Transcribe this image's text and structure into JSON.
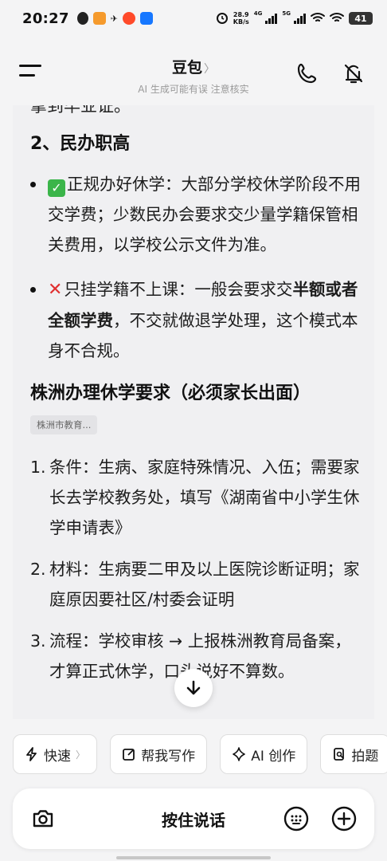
{
  "status_bar": {
    "time": "20:27",
    "net_speed_value": "28.9",
    "net_speed_unit": "KB/s",
    "net1": "4G",
    "net2": "5G",
    "battery": "41"
  },
  "header": {
    "title": "豆包",
    "subtitle": "AI 生成可能有误 注意核实"
  },
  "message": {
    "cut_text": "拿到毕业证。",
    "section2_heading": "2、民办职高",
    "bullets": [
      {
        "emoji": "✓",
        "lead": "正规办好休学：大部分学校休学阶段不用交学费；少数民办会要求交少量学籍保管相关费用，以学校公示文件为准。"
      },
      {
        "emoji": "✕",
        "lead": "只挂学籍不上课：一般会要求交",
        "bold": "半额或者全额学费",
        "tail": "，不交就做退学处理，这个模式本身不合规。"
      }
    ],
    "zhuzhou_heading": "株洲办理休学要求（必须家长出面）",
    "source_tag": "株洲市教育...",
    "steps": [
      {
        "num": "1.",
        "text": "条件：生病、家庭特殊情况、入伍；需要家长去学校教务处，填写《湖南省中小学生休学申请表》"
      },
      {
        "num": "2.",
        "text": "材料：生病要二甲及以上医院诊断证明；家庭原因要社区/村委会证明"
      },
      {
        "num": "3.",
        "text": "流程：学校审核 → 上报株洲教育局备案，才算正式休学，口头说好不算数。"
      }
    ]
  },
  "quick_actions": [
    {
      "label": "快速",
      "icon": "lightning-icon"
    },
    {
      "label": "帮我写作",
      "icon": "edit-icon"
    },
    {
      "label": "AI 创作",
      "icon": "sparkle-icon"
    },
    {
      "label": "拍题",
      "icon": "scan-icon"
    }
  ],
  "input_bar": {
    "hold_to_talk": "按住说话"
  },
  "colors": {
    "background": "#f4f4f5",
    "card": "#f0f0f2",
    "check_green": "#3bb54a",
    "cross_red": "#e02f2f"
  }
}
